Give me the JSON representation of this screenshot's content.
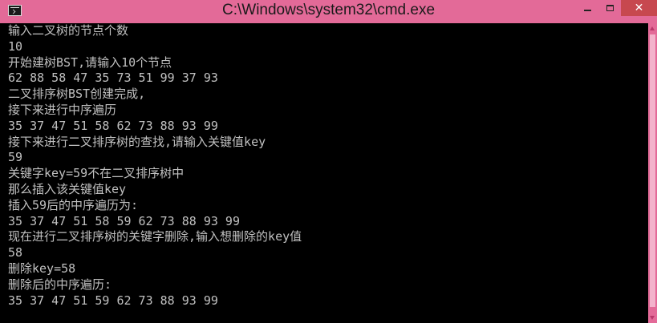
{
  "window": {
    "title": "C:\\Windows\\system32\\cmd.exe",
    "icon": "console-icon",
    "controls": {
      "minimize_icon": "minimize-icon",
      "maximize_icon": "maximize-icon",
      "close_label": "✕"
    },
    "colors": {
      "titlebar": "#e36a98",
      "close_button": "#c7484f",
      "console_background": "#000000",
      "console_text": "#c0c0c0"
    }
  },
  "console": {
    "lines": [
      "输入二叉树的节点个数",
      "10",
      "开始建树BST,请输入10个节点",
      "62 88 58 47 35 73 51 99 37 93",
      "二叉排序树BST创建完成,",
      "接下来进行中序遍历",
      "35 37 47 51 58 62 73 88 93 99",
      "接下来进行二叉排序树的查找,请输入关键值key",
      "59",
      "关键字key=59不在二叉排序树中",
      "那么插入该关键值key",
      "插入59后的中序遍历为:",
      "35 37 47 51 58 59 62 73 88 93 99",
      "现在进行二叉排序树的关键字删除,输入想删除的key值",
      "58",
      "删除key=58",
      "删除后的中序遍历:",
      "35 37 47 51 59 62 73 88 93 99"
    ]
  }
}
